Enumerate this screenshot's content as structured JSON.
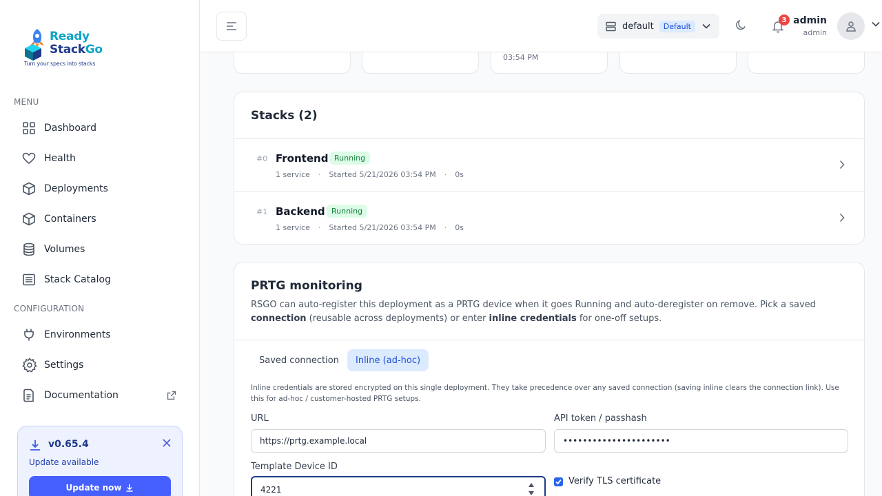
{
  "logo": {
    "word1": "Ready",
    "word2a": "Stack",
    "word2b": "Go",
    "tagline": "Turn your specs into stacks"
  },
  "sidebar": {
    "menu_label": "MENU",
    "menu_items": [
      {
        "label": "Dashboard",
        "icon": "grid-icon"
      },
      {
        "label": "Health",
        "icon": "heart-icon"
      },
      {
        "label": "Deployments",
        "icon": "box-icon"
      },
      {
        "label": "Containers",
        "icon": "box-icon"
      },
      {
        "label": "Volumes",
        "icon": "database-icon"
      },
      {
        "label": "Stack Catalog",
        "icon": "list-icon"
      }
    ],
    "config_label": "CONFIGURATION",
    "config_items": [
      {
        "label": "Environments",
        "icon": "plug-icon"
      },
      {
        "label": "Settings",
        "icon": "gear-icon"
      },
      {
        "label": "Documentation",
        "icon": "document-icon"
      }
    ],
    "update": {
      "version": "v0.65.4",
      "subtitle": "Update available",
      "button": "Update now"
    }
  },
  "header": {
    "environment": {
      "name": "default",
      "badge": "Default"
    },
    "notification_count": "3",
    "user": {
      "name": "admin",
      "role": "admin"
    }
  },
  "stat_cards": {
    "partial_time": "03:54 PM"
  },
  "stacks": {
    "title": "Stacks (2)",
    "items": [
      {
        "index": "#0",
        "name": "Frontend",
        "status": "Running",
        "services": "1 service",
        "started": "Started 5/21/2026 03:54 PM",
        "duration": "0s"
      },
      {
        "index": "#1",
        "name": "Backend",
        "status": "Running",
        "services": "1 service",
        "started": "Started 5/21/2026 03:54 PM",
        "duration": "0s"
      }
    ]
  },
  "prtg": {
    "title": "PRTG monitoring",
    "desc_1": "RSGO can auto-register this deployment as a PRTG device when it goes Running and auto-deregister on remove. Pick a saved ",
    "desc_b1": "connection",
    "desc_2": " (reusable across deployments) or enter ",
    "desc_b2": "inline credentials",
    "desc_3": " for one-off setups.",
    "tabs": {
      "saved": "Saved connection",
      "inline": "Inline (ad-hoc)"
    },
    "inline_note": "Inline credentials are stored encrypted on this single deployment. They take precedence over any saved connection (saving inline clears the connection link). Use this for ad-hoc / customer-hosted PRTG setups.",
    "url_label": "URL",
    "url_value": "https://prtg.example.local",
    "token_label": "API token / passhash",
    "token_value": "••••••••••••••••••••••",
    "template_label": "Template Device ID",
    "template_value": "4221",
    "verify_tls_label": "Verify TLS certificate",
    "verify_tls_checked": true
  },
  "colors": {
    "accent": "#465fff",
    "running_bg": "#dcfce7",
    "running_text": "#15803d",
    "badge_red": "#ef4444"
  }
}
